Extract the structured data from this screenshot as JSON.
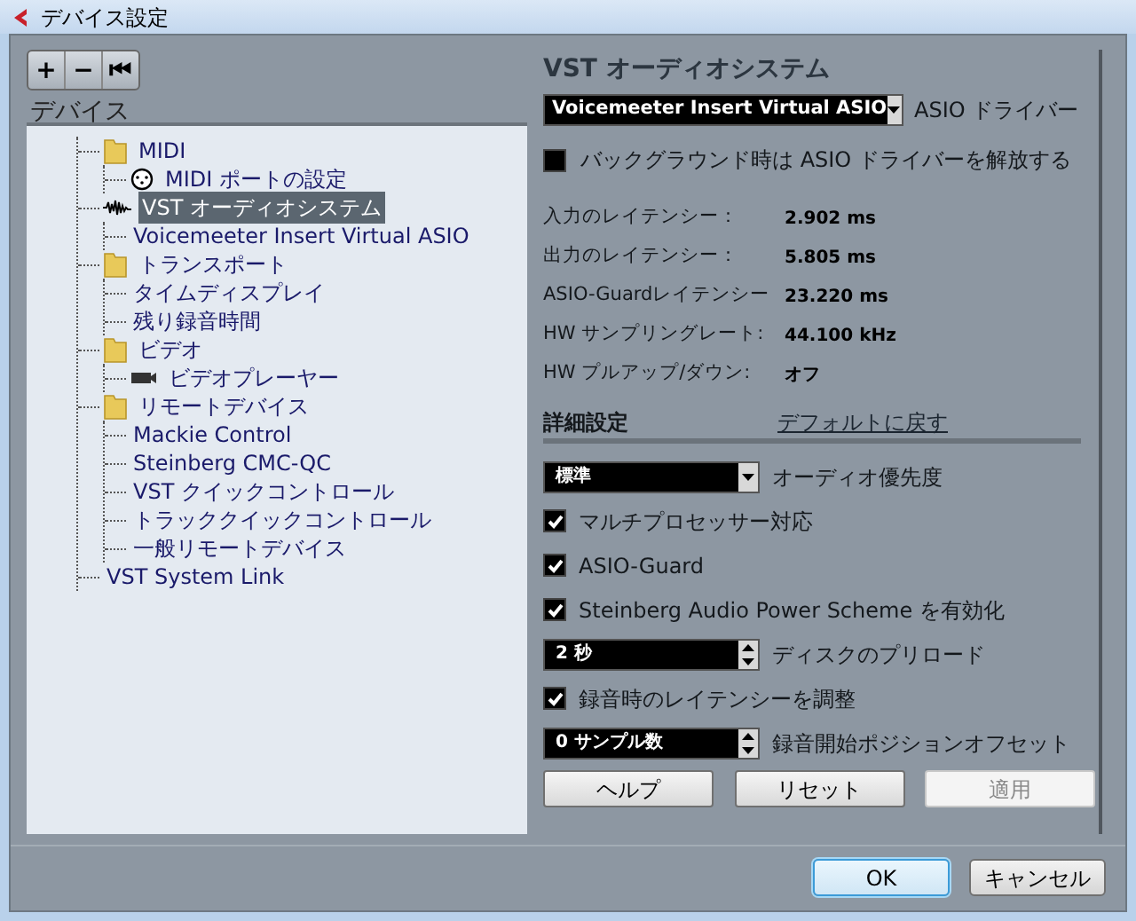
{
  "window": {
    "title": "デバイス設定"
  },
  "toolbar": {
    "buttons": [
      "+",
      "−",
      "⏮"
    ]
  },
  "tree": {
    "header": "デバイス",
    "items": [
      {
        "label": "MIDI",
        "kind": "folder",
        "selected": false,
        "children": [
          {
            "label": "MIDI ポートの設定",
            "kind": "midi",
            "selected": false
          }
        ]
      },
      {
        "label": "VST オーディオシステム",
        "kind": "audio",
        "selected": true,
        "children": [
          {
            "label": "Voicemeeter Insert Virtual ASIO",
            "kind": "plain",
            "selected": false
          }
        ]
      },
      {
        "label": "トランスポート",
        "kind": "folder",
        "selected": false,
        "children": [
          {
            "label": "タイムディスプレイ",
            "kind": "plain",
            "selected": false
          },
          {
            "label": "残り録音時間",
            "kind": "plain",
            "selected": false
          }
        ]
      },
      {
        "label": "ビデオ",
        "kind": "folder",
        "selected": false,
        "children": [
          {
            "label": "ビデオプレーヤー",
            "kind": "video",
            "selected": false
          }
        ]
      },
      {
        "label": "リモートデバイス",
        "kind": "folder",
        "selected": false,
        "children": [
          {
            "label": "Mackie Control",
            "kind": "plain",
            "selected": false
          },
          {
            "label": "Steinberg CMC-QC",
            "kind": "plain",
            "selected": false
          },
          {
            "label": "VST クイックコントロール",
            "kind": "plain",
            "selected": false
          },
          {
            "label": "トラッククイックコントロール",
            "kind": "plain",
            "selected": false
          },
          {
            "label": "一般リモートデバイス",
            "kind": "plain",
            "selected": false
          }
        ]
      },
      {
        "label": "VST System Link",
        "kind": "plain",
        "selected": false
      }
    ]
  },
  "panel": {
    "title": "VST オーディオシステム",
    "driver": {
      "value": "Voicemeeter Insert Virtual ASIO",
      "label": "ASIO ドライバー"
    },
    "release_option": {
      "label": "バックグラウンド時は ASIO ドライバーを解放する",
      "checked": false
    },
    "info": [
      {
        "label": "入力のレイテンシー：",
        "value": "2.902 ms"
      },
      {
        "label": "出力のレイテンシー：",
        "value": "5.805 ms"
      },
      {
        "label": "ASIO-Guardレイテンシー",
        "value": "23.220 ms"
      },
      {
        "label": "HW サンプリングレート:",
        "value": "44.100 kHz"
      },
      {
        "label": "HW プルアップ/ダウン:",
        "value": "オフ"
      }
    ],
    "advanced": {
      "title": "詳細設定",
      "reset_link": "デフォルトに戻す"
    },
    "settings": [
      {
        "kind": "dropdown",
        "setting": "標準",
        "label": "オーディオ優先度"
      },
      {
        "kind": "checkbox",
        "label": "マルチプロセッサー対応",
        "checked": true
      },
      {
        "kind": "checkbox",
        "label": "ASIO-Guard",
        "checked": true
      },
      {
        "kind": "checkbox",
        "label": "Steinberg Audio Power Scheme を有効化",
        "checked": true
      },
      {
        "kind": "spinner",
        "setting": "2 秒",
        "label": "ディスクのプリロード"
      },
      {
        "kind": "checkbox",
        "label": "録音時のレイテンシーを調整",
        "checked": true
      },
      {
        "kind": "spinner",
        "setting": "0 サンプル数",
        "label": "録音開始ポジションオフセット"
      }
    ],
    "buttons": [
      {
        "label": "ヘルプ",
        "disabled": false
      },
      {
        "label": "リセット",
        "disabled": false
      },
      {
        "label": "適用",
        "disabled": true
      }
    ]
  },
  "footer": {
    "buttons": [
      {
        "label": "OK",
        "default": true
      },
      {
        "label": "キャンセル",
        "default": false
      }
    ]
  }
}
